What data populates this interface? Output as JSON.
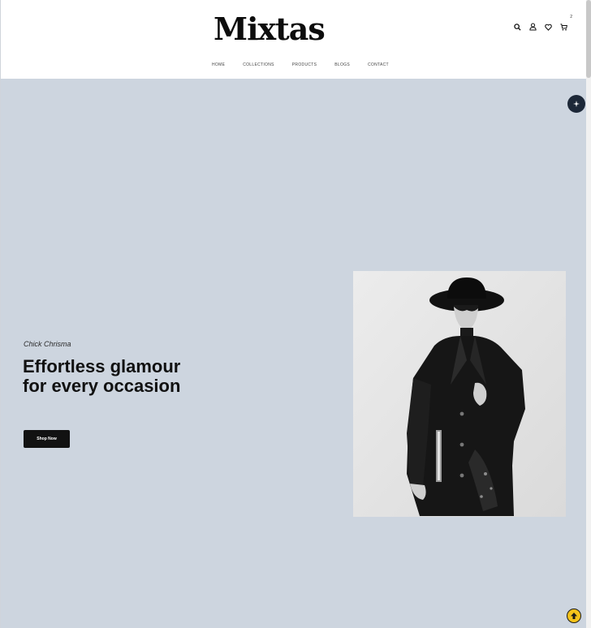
{
  "brand": {
    "logo": "Mixtas"
  },
  "nav": [
    {
      "label": "HOME"
    },
    {
      "label": "COLLECTIONS"
    },
    {
      "label": "PRODUCTS"
    },
    {
      "label": "BLOGS"
    },
    {
      "label": "CONTACT"
    }
  ],
  "header_icons": {
    "search": "search-icon",
    "account": "user-icon",
    "wishlist": "heart-icon",
    "cart": "cart-icon",
    "cart_count": "2"
  },
  "hero": {
    "subtitle": "Chick Chrisma",
    "headline": "Effortless glamour for every occasion",
    "cta_label": "Shop Now",
    "background_color": "#cdd5df",
    "image_alt": "man in black hat and long black coat"
  },
  "floating": {
    "badge_icon": "sparkle-icon",
    "back_to_top_icon": "arrow-up-icon"
  },
  "colors": {
    "hero_bg": "#cdd5df",
    "dark": "#121212",
    "accent_yellow": "#f4c21a",
    "badge_navy": "#1d2838"
  }
}
